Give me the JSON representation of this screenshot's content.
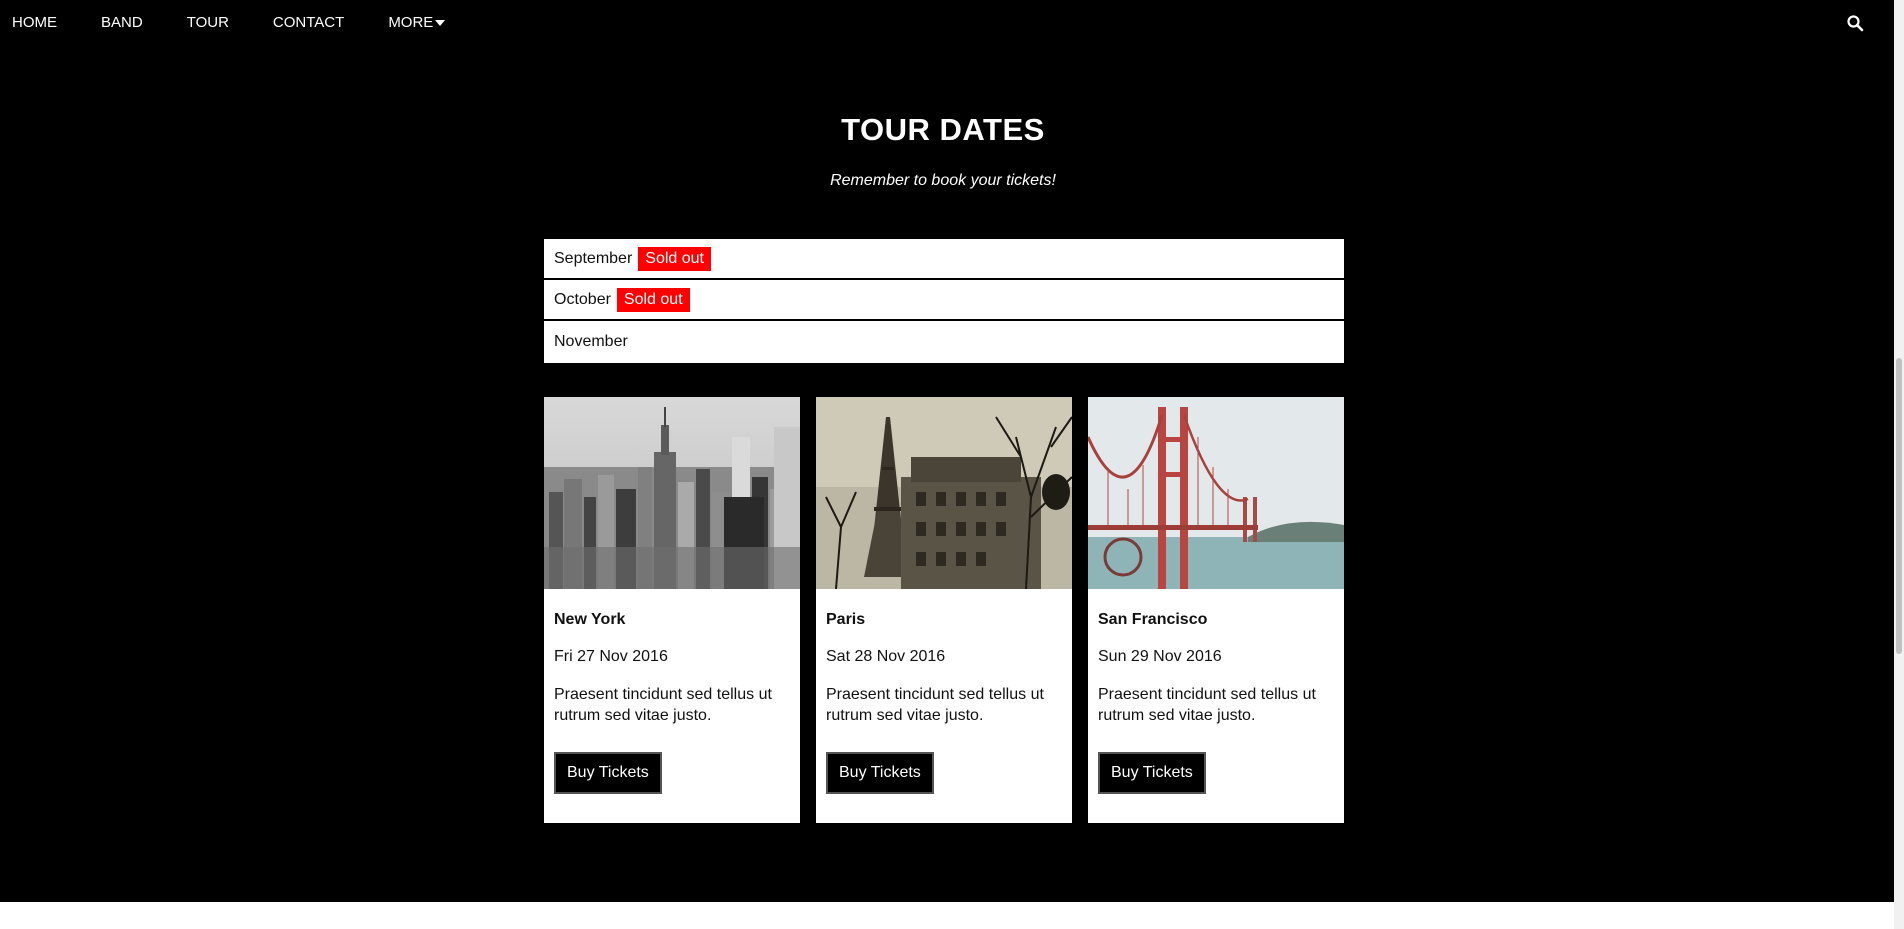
{
  "nav": {
    "items": [
      {
        "label": "HOME"
      },
      {
        "label": "BAND"
      },
      {
        "label": "TOUR"
      },
      {
        "label": "CONTACT"
      },
      {
        "label": "MORE"
      }
    ],
    "search_icon": "search-icon"
  },
  "tour": {
    "title": "TOUR DATES",
    "subtitle": "Remember to book your tickets!",
    "months": [
      {
        "name": "September",
        "badge": "Sold out"
      },
      {
        "name": "October",
        "badge": "Sold out"
      },
      {
        "name": "November",
        "badge": ""
      }
    ],
    "cards": [
      {
        "city": "New York",
        "date": "Fri 27 Nov 2016",
        "description": "Praesent tincidunt sed tellus ut rutrum sed vitae justo.",
        "button": "Buy Tickets"
      },
      {
        "city": "Paris",
        "date": "Sat 28 Nov 2016",
        "description": "Praesent tincidunt sed tellus ut rutrum sed vitae justo.",
        "button": "Buy Tickets"
      },
      {
        "city": "San Francisco",
        "date": "Sun 29 Nov 2016",
        "description": "Praesent tincidunt sed tellus ut rutrum sed vitae justo.",
        "button": "Buy Tickets"
      }
    ]
  },
  "colors": {
    "background": "#000000",
    "badge": "#ff0000",
    "card": "#ffffff"
  }
}
